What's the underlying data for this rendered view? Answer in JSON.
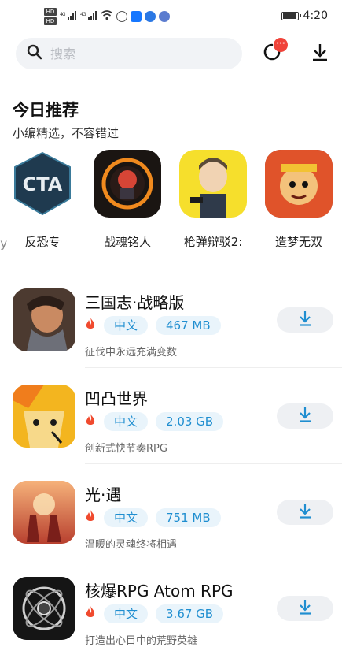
{
  "status_bar": {
    "time": "4:20",
    "hd_labels": [
      "HD",
      "HD"
    ],
    "net_labels": [
      "4G",
      "4G"
    ]
  },
  "search": {
    "placeholder": "搜索"
  },
  "header": {
    "badge": "···"
  },
  "recommend": {
    "title": "今日推荐",
    "subtitle": "小编精选，不容错过",
    "cut_label": "cy",
    "items": [
      {
        "label": "反恐专"
      },
      {
        "label": "战魂铭人"
      },
      {
        "label": "枪弹辩驳2:"
      },
      {
        "label": "造梦无双"
      }
    ]
  },
  "apps": [
    {
      "name": "三国志·战略版",
      "lang": "中文",
      "size": "467 MB",
      "desc": "征伐中永远充满变数"
    },
    {
      "name": "凹凸世界",
      "lang": "中文",
      "size": "2.03 GB",
      "desc": "创新式快节奏RPG"
    },
    {
      "name": "光·遇",
      "lang": "中文",
      "size": "751 MB",
      "desc": "温暖的灵魂终将相遇"
    },
    {
      "name": "核爆RPG Atom RPG",
      "lang": "中文",
      "size": "3.67 GB",
      "desc": "打造出心目中的荒野英雄"
    }
  ],
  "colors": {
    "accent": "#1f8ed0",
    "pill_bg": "#e9f4fb",
    "badge": "#f0433a",
    "flame": "#f04a2e"
  },
  "icons": [
    "search-icon",
    "refresh-icon",
    "download-icon",
    "flame-icon",
    "wifi-icon",
    "signal-icon",
    "battery-icon"
  ]
}
